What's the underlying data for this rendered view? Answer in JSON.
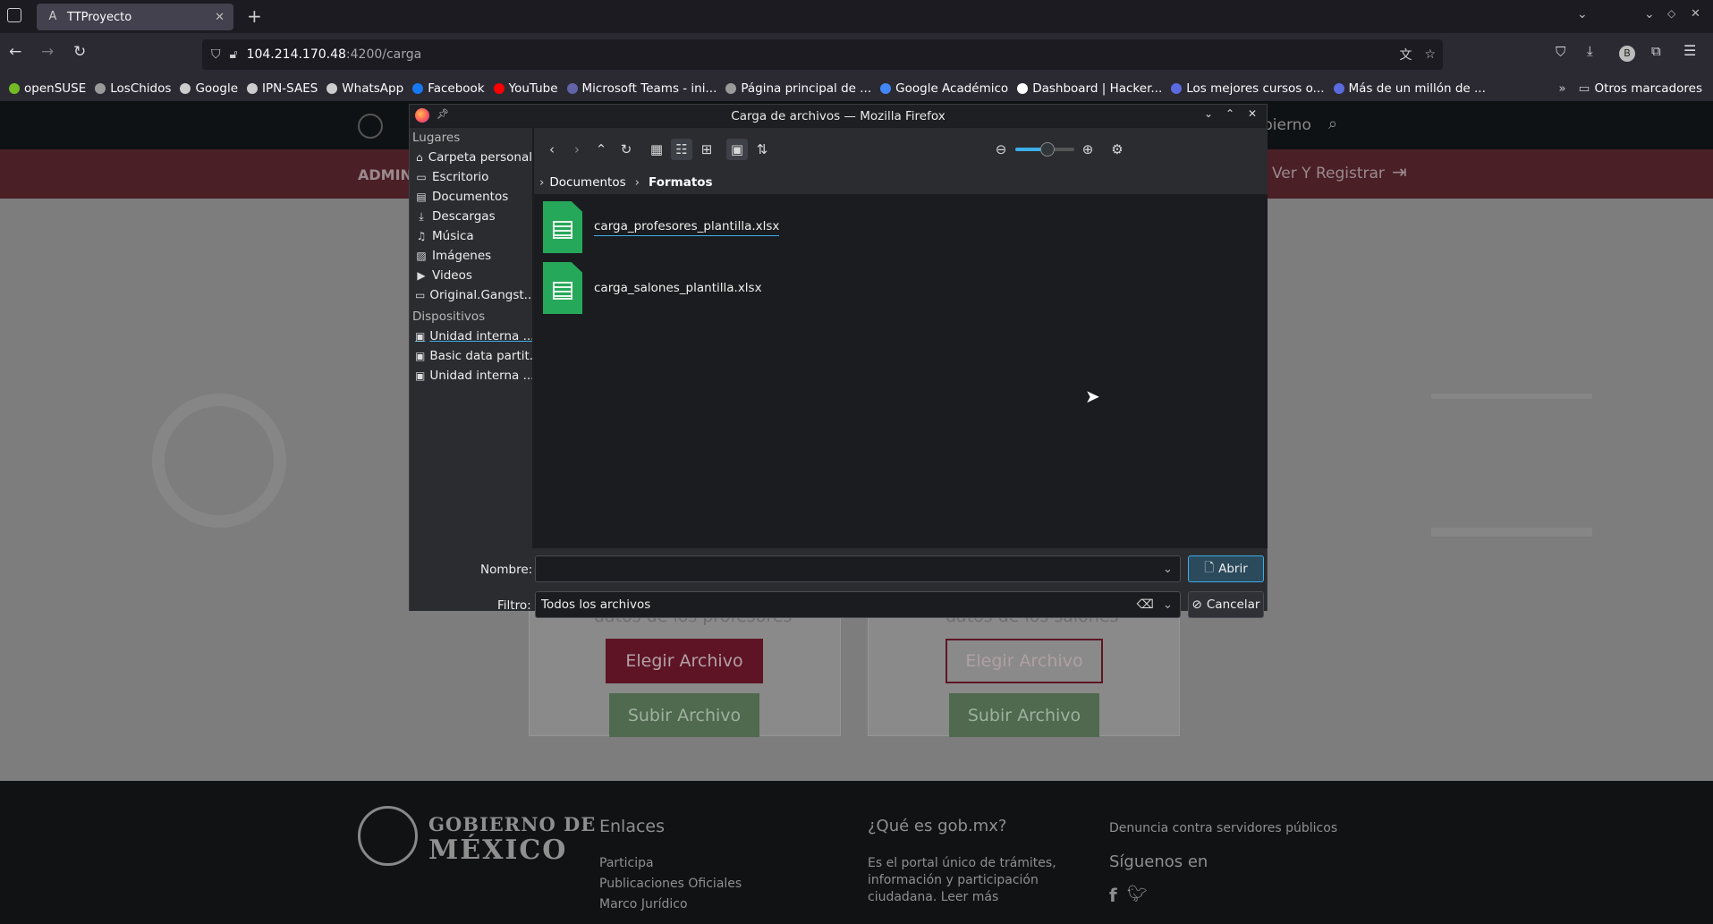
{
  "browser": {
    "tab_title": "TTProyecto",
    "url_host": "104.214.170.48",
    "url_path": ":4200/carga",
    "bookmarks": [
      {
        "label": "openSUSE",
        "color": "#73ba25"
      },
      {
        "label": "LosChidos",
        "color": "#9a9a9a"
      },
      {
        "label": "Google",
        "color": "#cccccc"
      },
      {
        "label": "IPN-SAES",
        "color": "#cccccc"
      },
      {
        "label": "WhatsApp",
        "color": "#cccccc"
      },
      {
        "label": "Facebook",
        "color": "#1877f2"
      },
      {
        "label": "YouTube",
        "color": "#ff0000"
      },
      {
        "label": "Microsoft Teams - ini...",
        "color": "#6264a7"
      },
      {
        "label": "Página principal de ...",
        "color": "#9a9a9a"
      },
      {
        "label": "Google Académico",
        "color": "#4285f4"
      },
      {
        "label": "Dashboard | Hacker...",
        "color": "#ffffff"
      },
      {
        "label": "Los mejores cursos o...",
        "color": "#5a6be0"
      },
      {
        "label": "Más de un millón de ...",
        "color": "#5a6be0"
      }
    ],
    "other_bookmarks": "Otros marcadores"
  },
  "site": {
    "menu_left": "ADMIN",
    "menu_right": "Ver Y Registrar",
    "header_right": "bierno",
    "cards": [
      {
        "subtitle": "datos de los profesores",
        "choose": "Elegir Archivo",
        "upload": "Subir Archivo"
      },
      {
        "subtitle": "datos de los salones",
        "choose": "Elegir Archivo",
        "upload": "Subir Archivo"
      }
    ],
    "footer": {
      "logo_line1": "GOBIERNO DE",
      "logo_line2": "MÉXICO",
      "links_title": "Enlaces",
      "links": [
        "Participa",
        "Publicaciones Oficiales",
        "Marco Jurídico"
      ],
      "about_title": "¿Qué es gob.mx?",
      "about_text": "Es el portal único de trámites, información y participación ciudadana. Leer más",
      "denuncia": "Denuncia contra servidores públicos",
      "follow": "Síguenos en"
    }
  },
  "dialog": {
    "title": "Carga de archivos — Mozilla Firefox",
    "places_header": "Lugares",
    "places": [
      {
        "label": "Carpeta personal",
        "icon": "home-icon"
      },
      {
        "label": "Escritorio",
        "icon": "desktop-icon"
      },
      {
        "label": "Documentos",
        "icon": "documents-icon"
      },
      {
        "label": "Descargas",
        "icon": "download-icon"
      },
      {
        "label": "Música",
        "icon": "music-icon"
      },
      {
        "label": "Imágenes",
        "icon": "image-icon"
      },
      {
        "label": "Videos",
        "icon": "video-icon"
      },
      {
        "label": "Original.Gangst...",
        "icon": "folder-icon"
      }
    ],
    "devices_header": "Dispositivos",
    "devices": [
      {
        "label": "Unidad interna ...",
        "icon": "drive-icon"
      },
      {
        "label": "Basic data partit...",
        "icon": "drive-icon"
      },
      {
        "label": "Unidad interna ...",
        "icon": "drive-icon"
      }
    ],
    "breadcrumb": [
      "Documentos",
      "Formatos"
    ],
    "files": [
      "carga_profesores_plantilla.xlsx",
      "carga_salones_plantilla.xlsx"
    ],
    "name_label": "Nombre:",
    "name_value": "",
    "filter_label": "Filtro:",
    "filter_value": "Todos los archivos",
    "open_button": "Abrir",
    "cancel_button": "Cancelar"
  }
}
